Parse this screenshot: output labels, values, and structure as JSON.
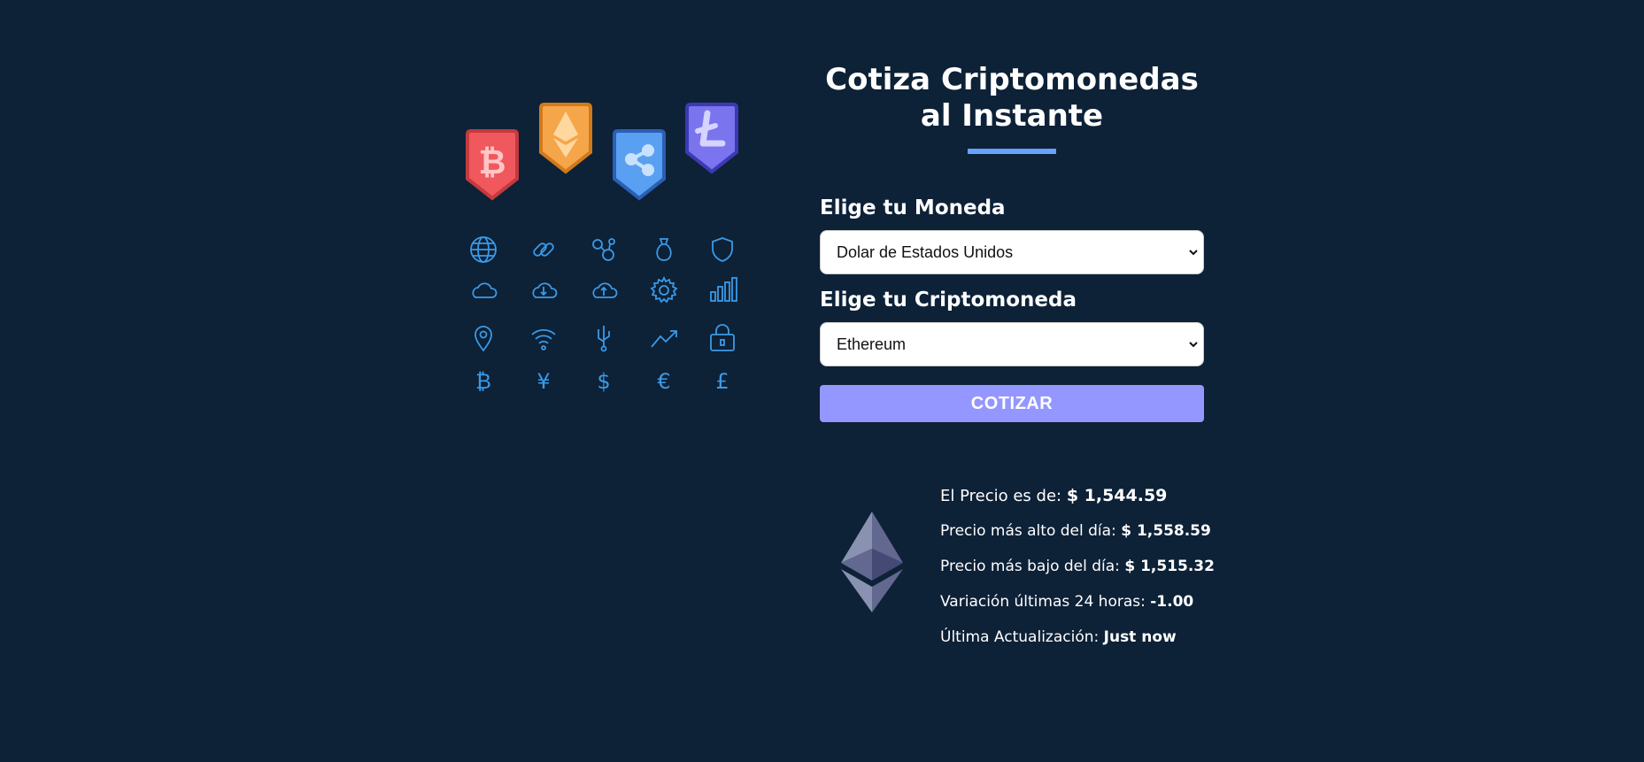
{
  "header": {
    "title": "Cotiza Criptomonedas al Instante"
  },
  "form": {
    "currency_label": "Elige tu Moneda",
    "currency_selected": "Dolar de Estados Unidos",
    "crypto_label": "Elige tu Criptomoneda",
    "crypto_selected": "Ethereum",
    "submit_label": "COTIZAR"
  },
  "result": {
    "price_label": "El Precio es de: ",
    "price_value": "$ 1,544.59",
    "high_label": "Precio más alto del día: ",
    "high_value": "$ 1,558.59",
    "low_label": "Precio más bajo del día: ",
    "low_value": "$ 1,515.32",
    "change_label": "Variación últimas 24 horas: ",
    "change_value": "-1.00",
    "updated_label": "Última Actualización: ",
    "updated_value": "Just now"
  },
  "icons": {
    "badges": [
      "bitcoin-badge-icon",
      "ethereum-badge-icon",
      "ripple-badge-icon",
      "litecoin-badge-icon"
    ],
    "grid": [
      "globe-icon",
      "link-icon",
      "nodes-icon",
      "money-bag-icon",
      "shield-icon",
      "cloud-icon",
      "cloud-download-icon",
      "cloud-upload-icon",
      "gear-icon",
      "bar-chart-icon",
      "map-pin-icon",
      "wifi-icon",
      "usb-icon",
      "trend-up-icon",
      "padlock-icon",
      "bitcoin-icon",
      "yen-icon",
      "dollar-icon",
      "euro-icon",
      "pound-icon"
    ]
  },
  "colors": {
    "background": "#0d2137",
    "accent_underline": "#66a2fe",
    "button": "#9497ff",
    "icon_stroke": "#3b9ae6"
  }
}
